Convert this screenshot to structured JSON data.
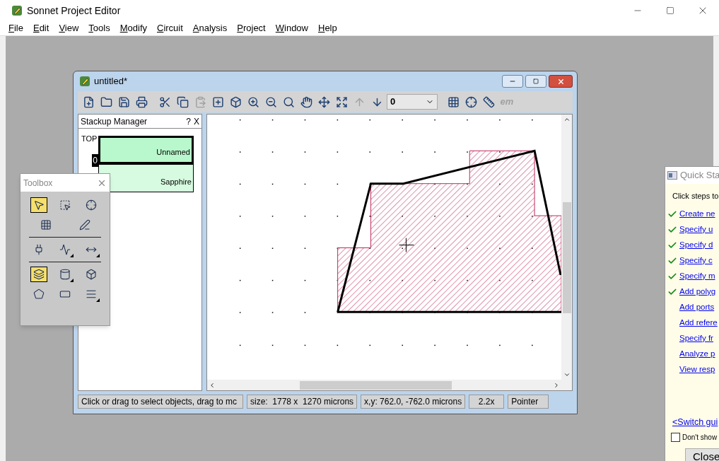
{
  "window": {
    "title": "Sonnet Project Editor"
  },
  "menu": [
    {
      "label": "File"
    },
    {
      "label": "Edit"
    },
    {
      "label": "View"
    },
    {
      "label": "Tools"
    },
    {
      "label": "Modify"
    },
    {
      "label": "Circuit"
    },
    {
      "label": "Analysis"
    },
    {
      "label": "Project"
    },
    {
      "label": "Window"
    },
    {
      "label": "Help"
    }
  ],
  "child_window": {
    "title": "untitled*",
    "toolbar": [
      {
        "kind": "new",
        "disabled": false,
        "gap_before": false
      },
      {
        "kind": "open",
        "disabled": false,
        "gap_before": false
      },
      {
        "kind": "save",
        "disabled": false,
        "gap_before": false
      },
      {
        "kind": "print",
        "disabled": false,
        "gap_before": false
      },
      {
        "kind": "cut",
        "disabled": false,
        "gap_before": true
      },
      {
        "kind": "copy",
        "disabled": false,
        "gap_before": false
      },
      {
        "kind": "paste",
        "disabled": true,
        "gap_before": false
      },
      {
        "kind": "new_box",
        "disabled": false,
        "gap_before": false
      },
      {
        "kind": "view3d",
        "disabled": false,
        "gap_before": false
      },
      {
        "kind": "zoom_in",
        "disabled": false,
        "gap_before": false
      },
      {
        "kind": "zoom_out",
        "disabled": false,
        "gap_before": false
      },
      {
        "kind": "zoom",
        "disabled": false,
        "gap_before": false
      },
      {
        "kind": "hand",
        "disabled": false,
        "gap_before": false
      },
      {
        "kind": "pan",
        "disabled": false,
        "gap_before": false
      },
      {
        "kind": "zoom_fit",
        "disabled": false,
        "gap_before": false
      },
      {
        "kind": "layer_up",
        "disabled": true,
        "gap_before": false
      },
      {
        "kind": "layer_down",
        "disabled": false,
        "gap_before": false
      },
      {
        "kind": "select",
        "value": "0",
        "disabled": false,
        "gap_before": false
      },
      {
        "kind": "grid",
        "disabled": false,
        "gap_before": true
      },
      {
        "kind": "snap",
        "disabled": false,
        "gap_before": false
      },
      {
        "kind": "ruler",
        "disabled": false,
        "gap_before": false
      },
      {
        "kind": "text",
        "label": "em",
        "disabled": true,
        "gap_before": false
      }
    ],
    "stackup": {
      "title": "Stackup Manager",
      "help": "?",
      "close": "X",
      "top_label": "TOP",
      "level_label": "0",
      "layers": [
        {
          "name": "Unnamed",
          "selected": true
        },
        {
          "name": "Sapphire",
          "selected": false
        }
      ]
    },
    "status_bar": [
      "Click or drag to select objects, drag to mc",
      "size:  1778 x  1270 microns",
      "x,y: 762.0, -762.0 microns",
      "2.2x",
      "Pointer"
    ]
  },
  "toolbox": {
    "title": "Toolbox",
    "rows": [
      {
        "divider_before": false,
        "tools": [
          {
            "kind": "pointer",
            "selected": true,
            "submenu": false
          },
          {
            "kind": "reshape",
            "selected": false,
            "submenu": false
          },
          {
            "kind": "add_point",
            "selected": false,
            "submenu": false
          }
        ]
      },
      {
        "divider_before": false,
        "tools": [
          {
            "kind": "snap",
            "selected": false,
            "submenu": false
          },
          {
            "kind": "edit",
            "selected": false,
            "submenu": false
          }
        ]
      },
      {
        "divider_before": true,
        "tools": [
          {
            "kind": "port",
            "selected": false,
            "submenu": false
          },
          {
            "kind": "component",
            "selected": false,
            "submenu": true
          },
          {
            "kind": "dimension",
            "selected": false,
            "submenu": true
          }
        ]
      },
      {
        "divider_before": true,
        "tools": [
          {
            "kind": "metal",
            "selected": true,
            "submenu": false
          },
          {
            "kind": "via",
            "selected": false,
            "submenu": true
          },
          {
            "kind": "brick",
            "selected": false,
            "submenu": false
          }
        ]
      },
      {
        "divider_before": false,
        "tools": [
          {
            "kind": "polygon",
            "selected": false,
            "submenu": false
          },
          {
            "kind": "rectangle",
            "selected": false,
            "submenu": false
          },
          {
            "kind": "layers",
            "selected": false,
            "submenu": true
          }
        ]
      }
    ]
  },
  "quick_start": {
    "title": "Quick Sta",
    "instruction": "Click steps to",
    "steps": [
      {
        "label": "Create ne",
        "done": true
      },
      {
        "label": "Specify u",
        "done": true
      },
      {
        "label": "Specify d",
        "done": true
      },
      {
        "label": "Specify c",
        "done": true
      },
      {
        "label": "Specify m",
        "done": true
      },
      {
        "label": "Add polyg",
        "done": true
      },
      {
        "label": "Add ports",
        "done": false
      },
      {
        "label": "Add refere",
        "done": false
      },
      {
        "label": "Specify fr",
        "done": false
      },
      {
        "label": "Analyze p",
        "done": false
      },
      {
        "label": "View resp",
        "done": false
      }
    ],
    "switch_link": "<Switch gui",
    "dont_show": {
      "label": "Don't show",
      "checked": false
    },
    "close_button": "Close"
  }
}
